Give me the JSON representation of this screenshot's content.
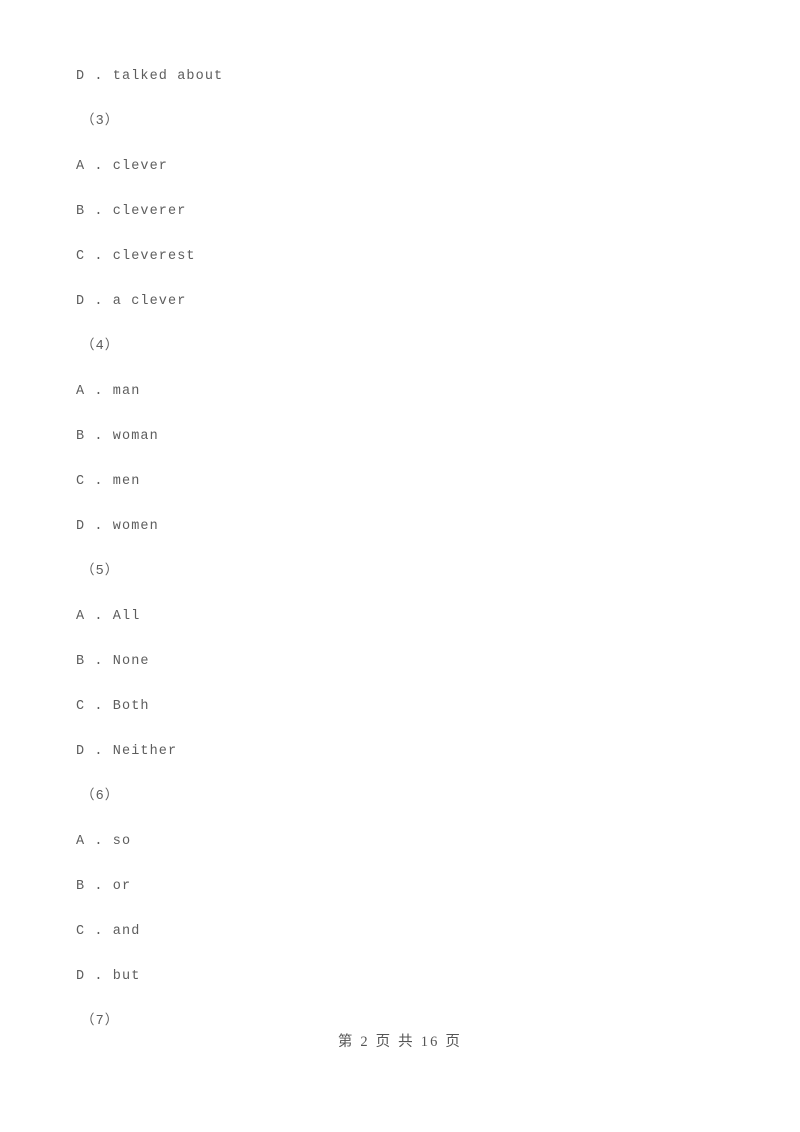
{
  "document": {
    "page_background": "#ffffff",
    "text_color": "#5d5d5d",
    "footer_color": "#555555"
  },
  "body_lines": [
    {
      "kind": "option",
      "text": "D . talked about"
    },
    {
      "kind": "question",
      "text": "（3）"
    },
    {
      "kind": "option",
      "text": "A . clever"
    },
    {
      "kind": "option",
      "text": "B . cleverer"
    },
    {
      "kind": "option",
      "text": "C . cleverest"
    },
    {
      "kind": "option",
      "text": "D . a clever"
    },
    {
      "kind": "question",
      "text": "（4）"
    },
    {
      "kind": "option",
      "text": "A . man"
    },
    {
      "kind": "option",
      "text": "B . woman"
    },
    {
      "kind": "option",
      "text": "C . men"
    },
    {
      "kind": "option",
      "text": "D . women"
    },
    {
      "kind": "question",
      "text": "（5）"
    },
    {
      "kind": "option",
      "text": "A . All"
    },
    {
      "kind": "option",
      "text": "B . None"
    },
    {
      "kind": "option",
      "text": "C . Both"
    },
    {
      "kind": "option",
      "text": "D . Neither"
    },
    {
      "kind": "question",
      "text": "（6）"
    },
    {
      "kind": "option",
      "text": "A . so"
    },
    {
      "kind": "option",
      "text": "B . or"
    },
    {
      "kind": "option",
      "text": "C . and"
    },
    {
      "kind": "option",
      "text": "D . but"
    },
    {
      "kind": "question",
      "text": "（7）"
    }
  ],
  "footer": {
    "text": "第 2 页 共 16 页",
    "current_page": "2",
    "total_pages": "16"
  }
}
